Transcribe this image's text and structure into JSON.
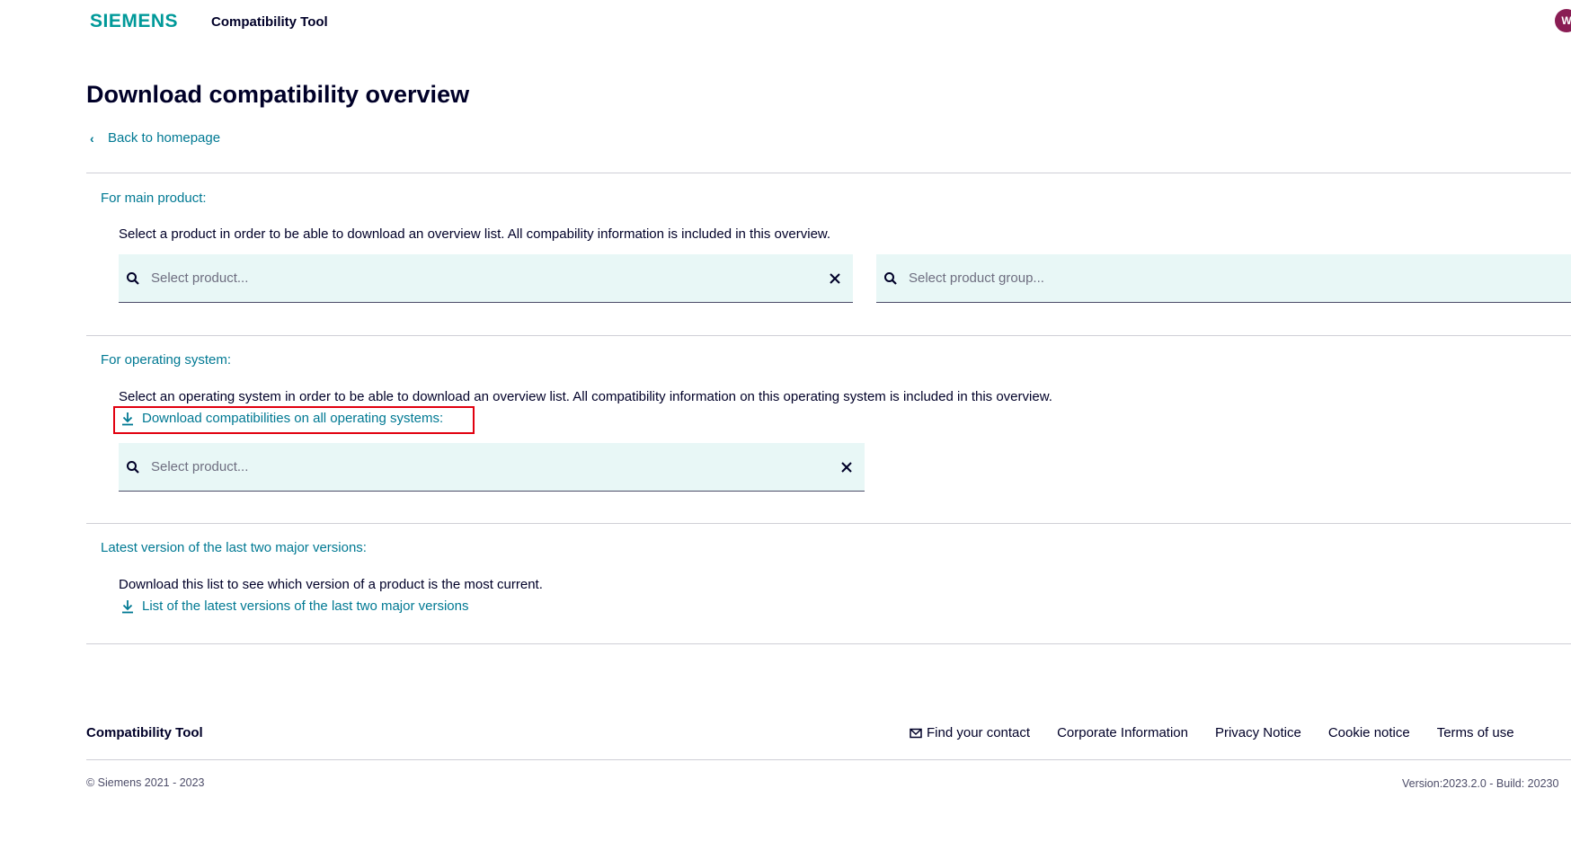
{
  "header": {
    "logo": "SIEMENS",
    "app_title": "Compatibility Tool",
    "avatar_initial": "W"
  },
  "page": {
    "title": "Download compatibility overview",
    "back_link": "Back to homepage"
  },
  "main_product": {
    "label": "For main product:",
    "description": "Select a product in order to be able to download an overview list. All compability information is included in this overview.",
    "product_placeholder": "Select product...",
    "group_placeholder": "Select product group..."
  },
  "operating_system": {
    "label": "For operating system:",
    "description": "Select an operating system in order to be able to download an overview list. All compatibility information on this operating system is included in this overview.",
    "download_link": "Download compatibilities on all operating systems:",
    "product_placeholder": "Select product..."
  },
  "latest_versions": {
    "label": "Latest version of the last two major versions:",
    "description": "Download this list to see which version of a product is the most current.",
    "download_link": "List of the latest versions of the last two major versions"
  },
  "footer": {
    "title": "Compatibility Tool",
    "links": [
      "Find your contact",
      "Corporate Information",
      "Privacy Notice",
      "Cookie notice",
      "Terms of use"
    ],
    "copyright": "© Siemens 2021 - 2023",
    "version": "Version:2023.2.0 - Build: 20230"
  },
  "icons": {
    "search": "search-icon",
    "clear": "close-icon",
    "download": "download-icon",
    "back": "chevron-left-icon",
    "mail": "mail-icon"
  },
  "colors": {
    "brand": "#009999",
    "link": "#007993",
    "text": "#000028",
    "input_bg": "#e8f7f6",
    "highlight": "#e1000f",
    "avatar": "#8a1d54"
  }
}
